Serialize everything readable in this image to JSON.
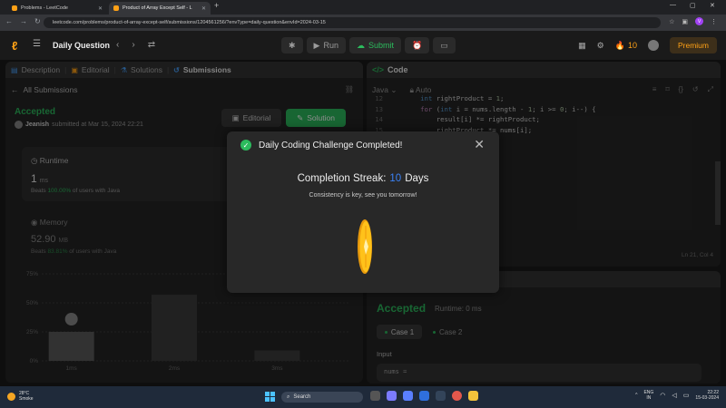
{
  "browser": {
    "tabs": [
      {
        "title": "Problems - LeetCode"
      },
      {
        "title": "Product of Array Except Self - L"
      }
    ],
    "url": "leetcode.com/problems/product-of-array-except-self/submissions/1204561256/?envType=daily-question&envId=2024-03-15",
    "profile_initial": "V"
  },
  "header": {
    "title": "Daily Question",
    "run_label": "Run",
    "submit_label": "Submit",
    "streak_count": "10",
    "premium_label": "Premium"
  },
  "left": {
    "tabs": [
      "Description",
      "Editorial",
      "Solutions",
      "Submissions"
    ],
    "all_submissions": "All Submissions",
    "status": "Accepted",
    "user": "Jeanish",
    "submitted_at": "submitted at Mar 15, 2024 22:21",
    "editorial_btn": "Editorial",
    "solution_btn": "Solution",
    "runtime": {
      "title": "Runtime",
      "value": "1",
      "unit": "ms",
      "beats_prefix": "Beats",
      "beats_pct": "100.00%",
      "beats_suffix": "of users with Java"
    },
    "memory": {
      "title": "Memory",
      "value": "52.90",
      "unit": "MB",
      "beats_prefix": "Beats",
      "beats_pct": "83.81%",
      "beats_suffix": "of users with Java"
    }
  },
  "chart_data": {
    "type": "bar",
    "categories": [
      "1ms",
      "2ms",
      "3ms"
    ],
    "values": [
      25,
      57,
      9
    ],
    "ylim": [
      0,
      75
    ],
    "yticks": [
      "0%",
      "25%",
      "50%",
      "75%"
    ],
    "grid": true
  },
  "code": {
    "tab_label": "Code",
    "language": "Java",
    "autosave": "Auto",
    "lines": [
      {
        "n": "12",
        "text": "        int rightProduct = 1;"
      },
      {
        "n": "13",
        "text": "        for (int i = nums.length - 1; i >= 0; i--) {"
      },
      {
        "n": "14",
        "text": "            result[i] *= rightProduct;"
      },
      {
        "n": "15",
        "text": "            rightProduct *= nums[i];"
      }
    ],
    "cursor": "Ln 21, Col 4"
  },
  "result": {
    "status": "Accepted",
    "runtime": "Runtime: 0 ms",
    "case1": "Case 1",
    "case2": "Case 2",
    "input_label": "Input",
    "input_value": "nums ="
  },
  "modal": {
    "title": "Daily Coding Challenge Completed!",
    "streak_prefix": "Completion Streak:",
    "streak_value": "10",
    "streak_suffix": "Days",
    "message": "Consistency is key, see you tomorrow!"
  },
  "taskbar": {
    "temp": "28°C",
    "weather": "Smoke",
    "search": "Search",
    "lang1": "ENG",
    "lang2": "IN",
    "time": "22:22",
    "date": "15-03-2024"
  },
  "colors": {
    "accent_green": "#2cbb5d",
    "leetcode_orange": "#ffa116",
    "streak_blue": "#3b82f6"
  }
}
